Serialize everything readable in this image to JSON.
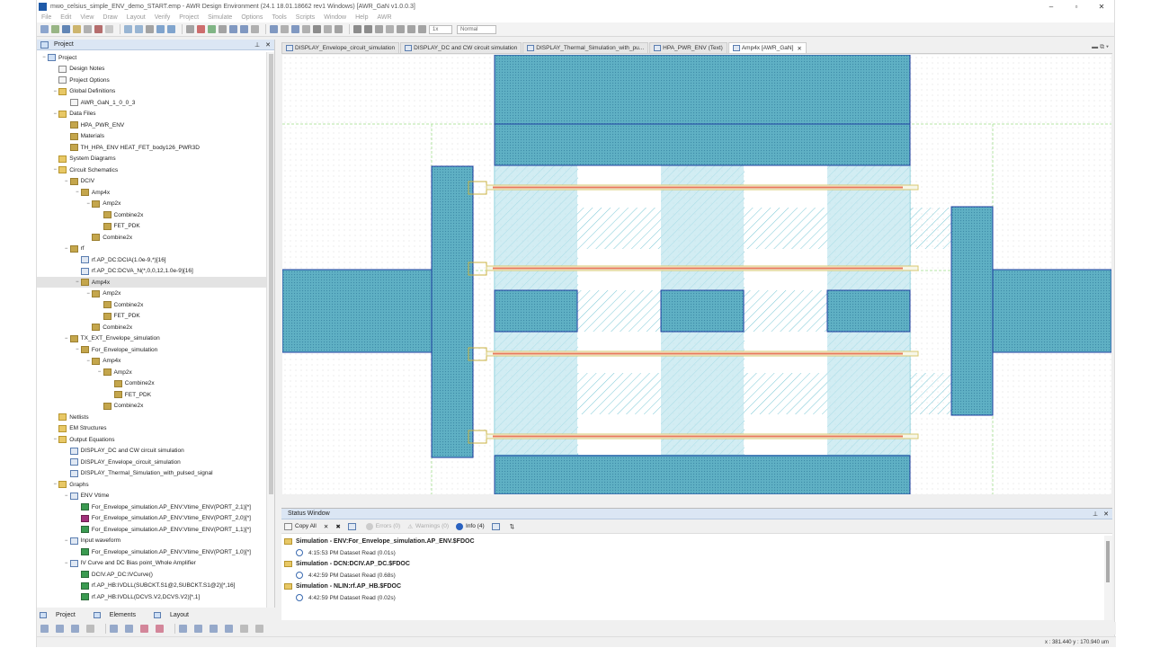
{
  "window": {
    "title": "mwo_celsius_simple_ENV_demo_START.emp - AWR Design Environment (24.1 18.01.18662 rev1 Windows) [AWR_GaN v1.0.0.3]",
    "minimize": "–",
    "maximize": "▫",
    "close": "✕"
  },
  "menu": [
    "File",
    "Edit",
    "View",
    "Draw",
    "Layout",
    "Verify",
    "Project",
    "Simulate",
    "Options",
    "Tools",
    "Scripts",
    "Window",
    "Help",
    "AWR"
  ],
  "toolbar": {
    "zoom": "1x",
    "mode": "Normal"
  },
  "project_panel": {
    "title": "Project",
    "tree": [
      {
        "label": "Project",
        "depth": 0,
        "toggle": "−",
        "icon": "grid"
      },
      {
        "label": "Design Notes",
        "depth": 1,
        "toggle": "",
        "icon": "doc"
      },
      {
        "label": "Project Options",
        "depth": 1,
        "toggle": "",
        "icon": "doc"
      },
      {
        "label": "Global Definitions",
        "depth": 1,
        "toggle": "−",
        "icon": "folder"
      },
      {
        "label": "AWR_GaN_1_0_0_3",
        "depth": 2,
        "toggle": "",
        "icon": "doc"
      },
      {
        "label": "Data Files",
        "depth": 1,
        "toggle": "−",
        "icon": "folder"
      },
      {
        "label": "HPA_PWR_ENV",
        "depth": 2,
        "toggle": "",
        "icon": "sch"
      },
      {
        "label": "Materials",
        "depth": 2,
        "toggle": "",
        "icon": "sch"
      },
      {
        "label": "TH_HPA_ENV HEAT_FET_body126_PWR3D",
        "depth": 2,
        "toggle": "",
        "icon": "sch"
      },
      {
        "label": "System Diagrams",
        "depth": 1,
        "toggle": "",
        "icon": "folder"
      },
      {
        "label": "Circuit Schematics",
        "depth": 1,
        "toggle": "−",
        "icon": "folder"
      },
      {
        "label": "DCIV",
        "depth": 2,
        "toggle": "−",
        "icon": "sch"
      },
      {
        "label": "Amp4x",
        "depth": 3,
        "toggle": "−",
        "icon": "sch"
      },
      {
        "label": "Amp2x",
        "depth": 4,
        "toggle": "−",
        "icon": "sch"
      },
      {
        "label": "Combine2x",
        "depth": 5,
        "toggle": "",
        "icon": "sch"
      },
      {
        "label": "FET_PDK",
        "depth": 5,
        "toggle": "",
        "icon": "sch"
      },
      {
        "label": "Combine2x",
        "depth": 4,
        "toggle": "",
        "icon": "sch"
      },
      {
        "label": "rf",
        "depth": 2,
        "toggle": "−",
        "icon": "sch"
      },
      {
        "label": "rf.AP_DC:DCIA(1.0e-9,*)[16]",
        "depth": 3,
        "toggle": "",
        "icon": "graph"
      },
      {
        "label": "rf.AP_DC:DCVA_N(*,0,0,12,1.0e-9)[16]",
        "depth": 3,
        "toggle": "",
        "icon": "graph"
      },
      {
        "label": "Amp4x",
        "depth": 3,
        "toggle": "−",
        "icon": "sch",
        "selected": true
      },
      {
        "label": "Amp2x",
        "depth": 4,
        "toggle": "−",
        "icon": "sch"
      },
      {
        "label": "Combine2x",
        "depth": 5,
        "toggle": "",
        "icon": "sch"
      },
      {
        "label": "FET_PDK",
        "depth": 5,
        "toggle": "",
        "icon": "sch"
      },
      {
        "label": "Combine2x",
        "depth": 4,
        "toggle": "",
        "icon": "sch"
      },
      {
        "label": "TX_EXT_Envelope_simulation",
        "depth": 2,
        "toggle": "−",
        "icon": "sch"
      },
      {
        "label": "For_Envelope_simulation",
        "depth": 3,
        "toggle": "−",
        "icon": "sch"
      },
      {
        "label": "Amp4x",
        "depth": 4,
        "toggle": "−",
        "icon": "sch"
      },
      {
        "label": "Amp2x",
        "depth": 5,
        "toggle": "−",
        "icon": "sch"
      },
      {
        "label": "Combine2x",
        "depth": 6,
        "toggle": "",
        "icon": "sch"
      },
      {
        "label": "FET_PDK",
        "depth": 6,
        "toggle": "",
        "icon": "sch"
      },
      {
        "label": "Combine2x",
        "depth": 5,
        "toggle": "",
        "icon": "sch"
      },
      {
        "label": "Netlists",
        "depth": 1,
        "toggle": "",
        "icon": "folder"
      },
      {
        "label": "EM Structures",
        "depth": 1,
        "toggle": "",
        "icon": "folder"
      },
      {
        "label": "Output Equations",
        "depth": 1,
        "toggle": "−",
        "icon": "folder"
      },
      {
        "label": "DISPLAY_DC and CW circuit simulation",
        "depth": 2,
        "toggle": "",
        "icon": "graph"
      },
      {
        "label": "DISPLAY_Envelope_circuit_simulation",
        "depth": 2,
        "toggle": "",
        "icon": "graph"
      },
      {
        "label": "DISPLAY_Thermal_Simulation_with_pulsed_signal",
        "depth": 2,
        "toggle": "",
        "icon": "graph"
      },
      {
        "label": "Graphs",
        "depth": 1,
        "toggle": "−",
        "icon": "folder"
      },
      {
        "label": "ENV Vtime",
        "depth": 2,
        "toggle": "−",
        "icon": "graph"
      },
      {
        "label": "For_Envelope_simulation.AP_ENV:Vtime_ENV(PORT_2,1)[*]",
        "depth": 3,
        "toggle": "",
        "icon": "trace"
      },
      {
        "label": "For_Envelope_simulation.AP_ENV:Vtime_ENV(PORT_2,0)[*]",
        "depth": 3,
        "toggle": "",
        "icon": "trace2"
      },
      {
        "label": "For_Envelope_simulation.AP_ENV:Vtime_ENV(PORT_1,1)[*]",
        "depth": 3,
        "toggle": "",
        "icon": "trace"
      },
      {
        "label": "Input waveform",
        "depth": 2,
        "toggle": "−",
        "icon": "graph"
      },
      {
        "label": "For_Envelope_simulation.AP_ENV:Vtime_ENV(PORT_1,0)[*]",
        "depth": 3,
        "toggle": "",
        "icon": "trace"
      },
      {
        "label": "IV Curve and DC Bias point_Whole Amplifier",
        "depth": 2,
        "toggle": "−",
        "icon": "graph"
      },
      {
        "label": "DCIV.AP_DC:IVCurve()",
        "depth": 3,
        "toggle": "",
        "icon": "trace"
      },
      {
        "label": "rf.AP_HB:IVDLL(SUBCKT.S1@2,SUBCKT.S1@2)[*,16]",
        "depth": 3,
        "toggle": "",
        "icon": "trace"
      },
      {
        "label": "rf.AP_HB:IVDLL(DCVS.V2,DCVS.V2)[*,1]",
        "depth": 3,
        "toggle": "",
        "icon": "trace"
      }
    ]
  },
  "bottom_tabs": [
    "Project",
    "Elements",
    "Layout"
  ],
  "doc_tabs": [
    {
      "label": "DISPLAY_Envelope_circuit_simulation",
      "active": false
    },
    {
      "label": "DISPLAY_DC and CW circuit simulation",
      "active": false
    },
    {
      "label": "DISPLAY_Thermal_Simulation_with_pu...",
      "active": false
    },
    {
      "label": "HPA_PWR_ENV (Text)",
      "active": false
    },
    {
      "label": "Amp4x [AWR_GaN]",
      "active": true
    }
  ],
  "status_window": {
    "title": "Status Window",
    "copy_all": "Copy All",
    "errors": "Errors (0)",
    "warnings": "Warnings (0)",
    "info": "Info (4)",
    "messages": [
      {
        "title": "Simulation - ENV:For_Envelope_simulation.AP_ENV.$FDOC",
        "detail": "4:15:53 PM Dataset Read (0.01s)"
      },
      {
        "title": "Simulation - DCN:DCIV.AP_DC.$FDOC",
        "detail": "4:42:59 PM Dataset Read (0.68s)"
      },
      {
        "title": "Simulation - NLIN:rf.AP_HB.$FDOC",
        "detail": "4:42:59 PM Dataset Read (0.02s)"
      }
    ]
  },
  "statusbar": {
    "coords": "x : 381.440  y : 170.940  um"
  },
  "colors": {
    "metal": "#4fa8c0",
    "metal_edge": "#1f3fa0",
    "hatch": "#7ac8d6",
    "gate": "#e87a5a",
    "grid_dot": "#dddddd"
  }
}
